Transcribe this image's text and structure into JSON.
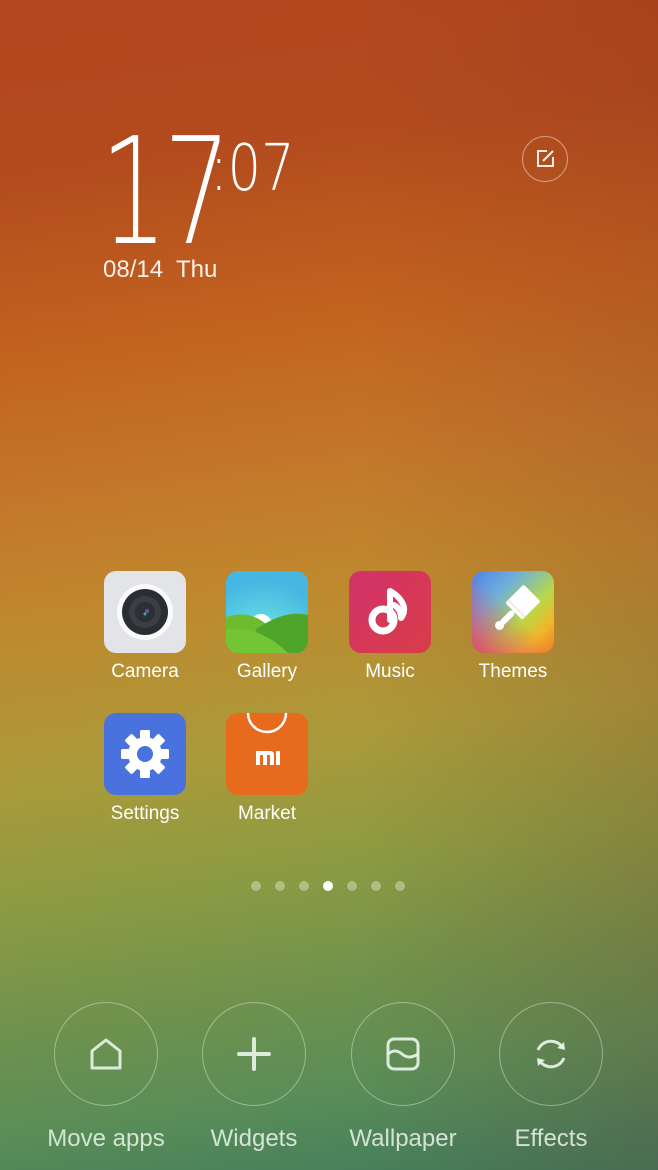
{
  "clock": {
    "hour": "17",
    "minute": ":07",
    "date": "08/14  Thu"
  },
  "edit_button": {
    "icon": "edit-icon"
  },
  "apps": [
    {
      "label": "Camera",
      "icon": "camera-icon"
    },
    {
      "label": "Gallery",
      "icon": "gallery-icon"
    },
    {
      "label": "Music",
      "icon": "music-icon"
    },
    {
      "label": "Themes",
      "icon": "themes-brush-icon"
    },
    {
      "label": "Settings",
      "icon": "gear-icon"
    },
    {
      "label": "Market",
      "icon": "mi-market-icon",
      "icon_text": "mi"
    }
  ],
  "pager": {
    "total_pages": 7,
    "current_page": 4
  },
  "bottom_actions": [
    {
      "label": "Move apps",
      "icon": "home-icon"
    },
    {
      "label": "Widgets",
      "icon": "plus-icon"
    },
    {
      "label": "Wallpaper",
      "icon": "wallpaper-icon"
    },
    {
      "label": "Effects",
      "icon": "refresh-icon"
    }
  ]
}
